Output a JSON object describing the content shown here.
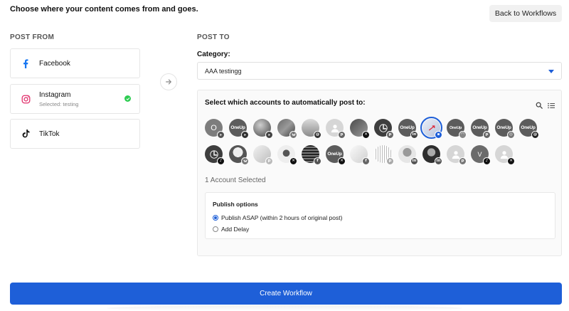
{
  "header": {
    "headline": "Choose where your content comes from and goes.",
    "back_label": "Back to Workflows"
  },
  "post_from": {
    "label": "POST FROM",
    "sources": [
      {
        "name": "Facebook",
        "sub": "",
        "icon": "facebook-icon",
        "selected": false
      },
      {
        "name": "Instagram",
        "sub": "Selected: testing",
        "icon": "instagram-icon",
        "selected": true
      },
      {
        "name": "TikTok",
        "sub": "",
        "icon": "tiktok-icon",
        "selected": false
      }
    ]
  },
  "post_to": {
    "label": "POST TO",
    "category_label": "Category:",
    "category_value": "AAA testingg",
    "accounts_title": "Select which accounts to automatically post to:",
    "accounts_count": "1 Account Selected",
    "avatar_text": {
      "first_initial": "O",
      "oneup": "OneUp",
      "v_initial": "V"
    },
    "publish": {
      "title": "Publish options",
      "options": [
        {
          "label": "Publish ASAP (within 2 hours of original post)",
          "checked": true
        },
        {
          "label": "Add Delay",
          "checked": false
        }
      ]
    }
  },
  "footer": {
    "create_label": "Create Workflow"
  },
  "colors": {
    "accent": "#1e5fd8",
    "success": "#2ecc52",
    "facebook": "#1877f2",
    "instagram": "#e1306c"
  }
}
